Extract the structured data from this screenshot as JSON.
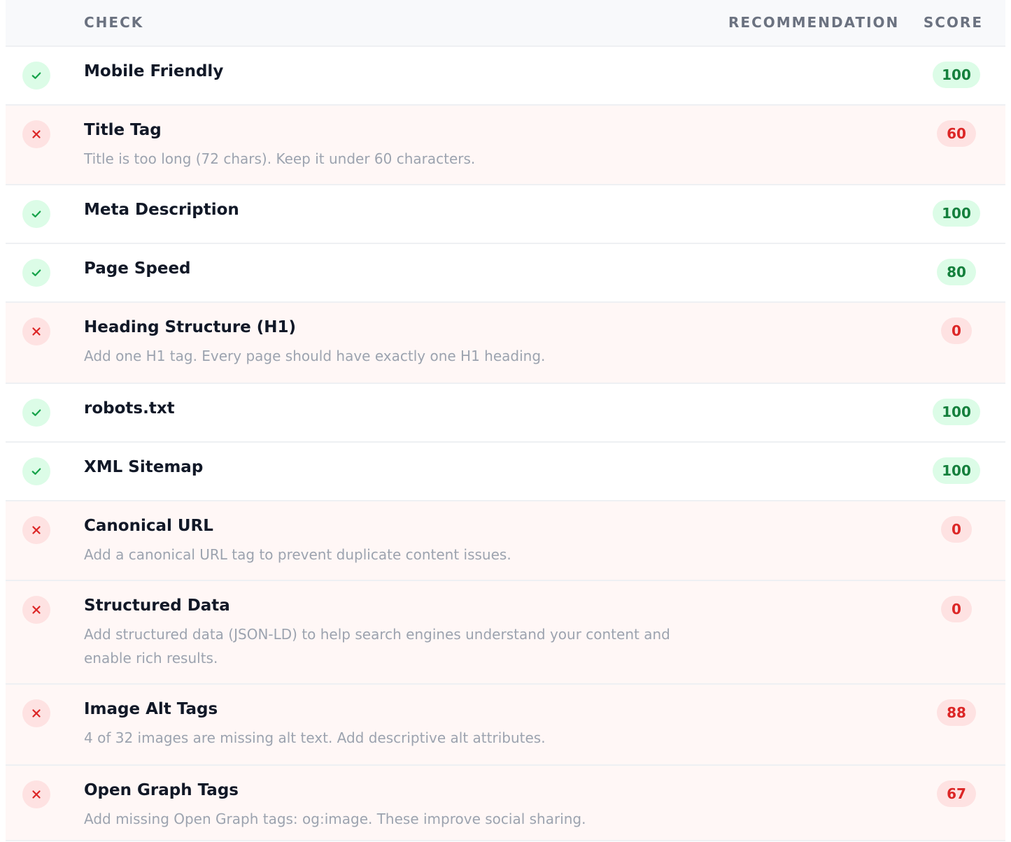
{
  "header": {
    "check": "CHECK",
    "recommendation": "RECOMMENDATION",
    "score": "SCORE"
  },
  "colors": {
    "pass": "#16a34a",
    "fail": "#dc2626",
    "pass_bg": "#dcfce7",
    "fail_bg": "#fee2e2",
    "fail_row_bg": "#fff7f6"
  },
  "rows": [
    {
      "status": "pass",
      "status_icon": "check-icon",
      "name": "Mobile Friendly",
      "recommendation": "",
      "score": "100"
    },
    {
      "status": "fail",
      "status_icon": "x-icon",
      "name": "Title Tag",
      "recommendation": "Title is too long (72 chars). Keep it under 60 characters.",
      "score": "60"
    },
    {
      "status": "pass",
      "status_icon": "check-icon",
      "name": "Meta Description",
      "recommendation": "",
      "score": "100"
    },
    {
      "status": "pass",
      "status_icon": "check-icon",
      "name": "Page Speed",
      "recommendation": "",
      "score": "80"
    },
    {
      "status": "fail",
      "status_icon": "x-icon",
      "name": "Heading Structure (H1)",
      "recommendation": "Add one H1 tag. Every page should have exactly one H1 heading.",
      "score": "0"
    },
    {
      "status": "pass",
      "status_icon": "check-icon",
      "name": "robots.txt",
      "recommendation": "",
      "score": "100"
    },
    {
      "status": "pass",
      "status_icon": "check-icon",
      "name": "XML Sitemap",
      "recommendation": "",
      "score": "100"
    },
    {
      "status": "fail",
      "status_icon": "x-icon",
      "name": "Canonical URL",
      "recommendation": "Add a canonical URL tag to prevent duplicate content issues.",
      "score": "0"
    },
    {
      "status": "fail",
      "status_icon": "x-icon",
      "name": "Structured Data",
      "recommendation": "Add structured data (JSON-LD) to help search engines understand your content and enable rich results.",
      "score": "0"
    },
    {
      "status": "fail",
      "status_icon": "x-icon",
      "name": "Image Alt Tags",
      "recommendation": "4 of 32 images are missing alt text. Add descriptive alt attributes.",
      "score": "88"
    },
    {
      "status": "fail",
      "status_icon": "x-icon",
      "name": "Open Graph Tags",
      "recommendation": "Add missing Open Graph tags: og:image. These improve social sharing.",
      "score": "67"
    }
  ]
}
